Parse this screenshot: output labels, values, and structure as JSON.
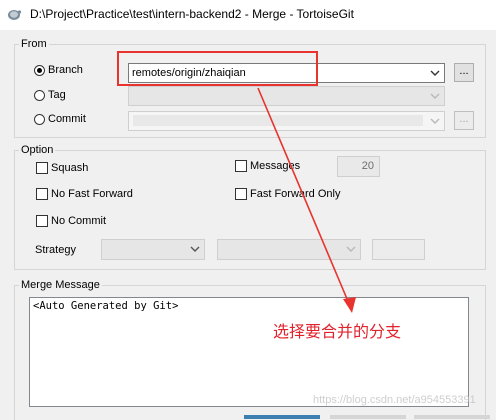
{
  "window": {
    "title": "D:\\Project\\Practice\\test\\intern-backend2 - Merge - TortoiseGit"
  },
  "from": {
    "legend": "From",
    "branch_label": "Branch",
    "branch_value": "remotes/origin/zhaiqian",
    "tag_label": "Tag",
    "commit_label": "Commit",
    "browse_label": "..."
  },
  "option": {
    "legend": "Option",
    "squash": "Squash",
    "messages": "Messages",
    "messages_count": "20",
    "no_fast_forward": "No Fast Forward",
    "fast_forward_only": "Fast Forward Only",
    "no_commit": "No Commit",
    "strategy": "Strategy"
  },
  "merge_message": {
    "legend": "Merge Message",
    "text": "<Auto Generated by Git>"
  },
  "annotation": {
    "text": "选择要合并的分支",
    "color": "#e0232c"
  },
  "watermark": "https://blog.csdn.net/a954553391",
  "icons": [
    "tortoisegit-icon",
    "chevron-down-icon",
    "arrow-annotation-icon"
  ]
}
